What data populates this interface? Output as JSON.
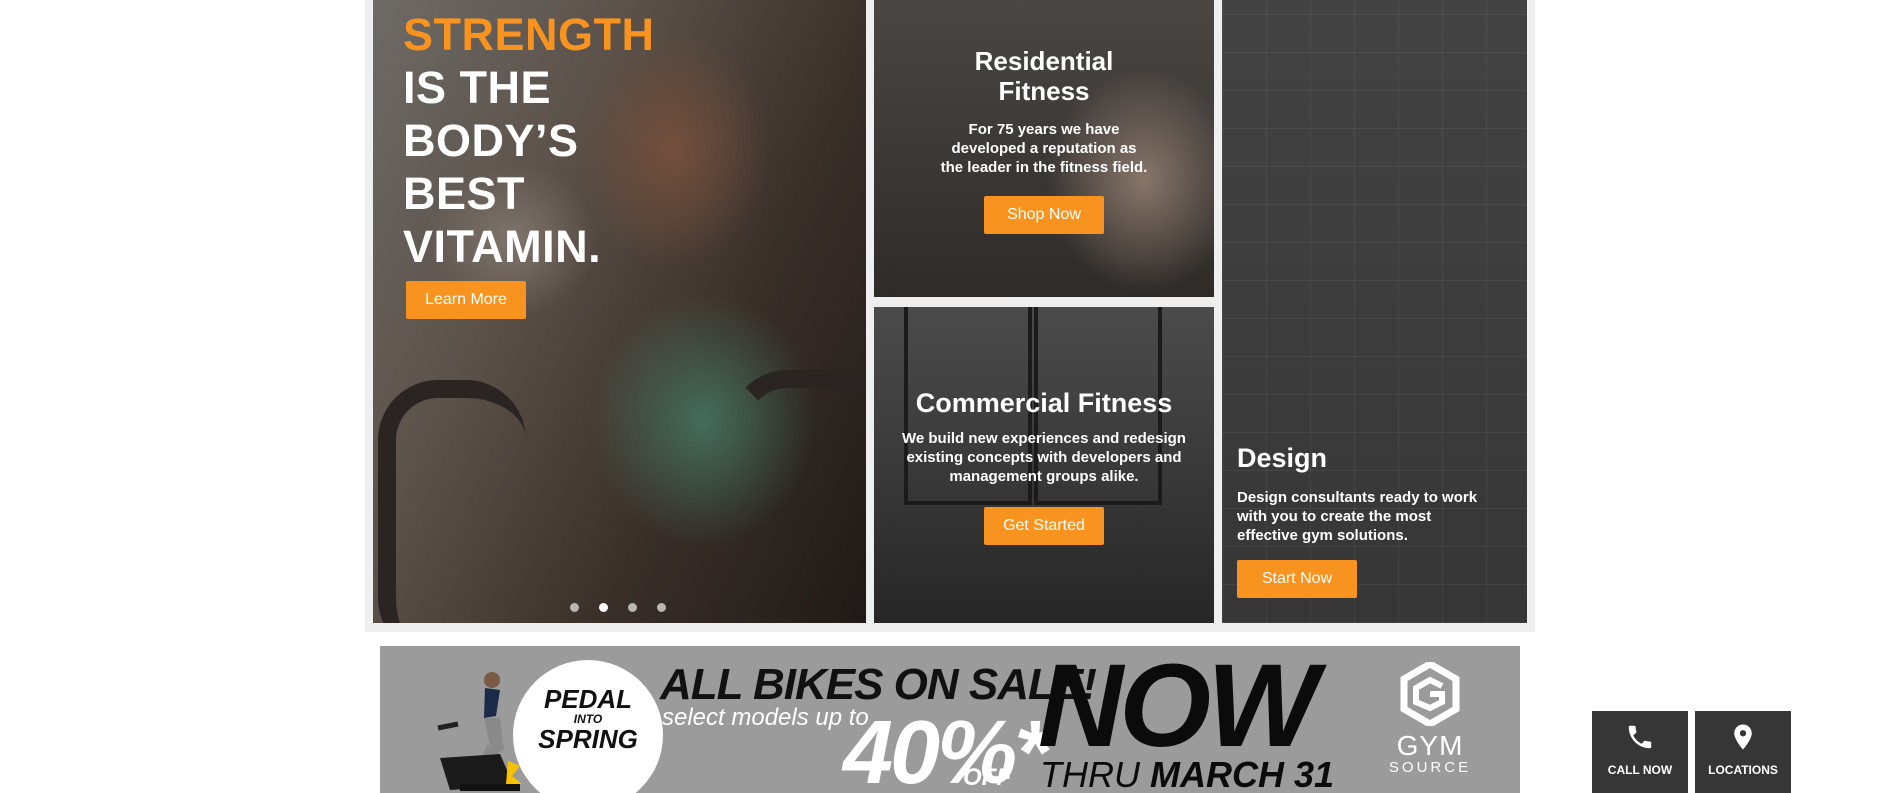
{
  "hero": {
    "title_line1": "STRENGTH",
    "title_line2": "IS THE",
    "title_line3": "BODY’S",
    "title_line4": "BEST",
    "title_line5": "VITAMIN.",
    "button": "Learn More",
    "slides": 4,
    "active_slide": 2
  },
  "residential": {
    "title_line1": "Residential",
    "title_line2": "Fitness",
    "desc_line1": "For 75 years we have",
    "desc_line2": "developed a reputation as",
    "desc_line3": "the leader in the fitness field.",
    "button": "Shop Now"
  },
  "commercial": {
    "title": "Commercial Fitness",
    "desc_line1": "We build new experiences and redesign",
    "desc_line2": "existing concepts with developers and",
    "desc_line3": "management groups alike.",
    "button": "Get Started"
  },
  "design": {
    "title": "Design",
    "desc_line1": "Design consultants ready to work",
    "desc_line2": "with you to create the most",
    "desc_line3": "effective gym solutions.",
    "button": "Start Now"
  },
  "banner": {
    "circle_line1": "PEDAL",
    "circle_line2": "INTO",
    "circle_line3": "SPRING",
    "headline": "ALL BIKES ON SALE!",
    "subline": "select models up to",
    "percent": "40%*",
    "off": "OFF",
    "now": "NOW",
    "thru": "THRU",
    "date": "MARCH 31",
    "logo_name": "GYM",
    "logo_sub": "SOURCE"
  },
  "floating": {
    "call": "CALL NOW",
    "locations": "LOCATIONS"
  },
  "colors": {
    "accent": "#f7931e",
    "dark_button": "#363636"
  },
  "icons": {
    "call": "phone-icon",
    "locations": "map-pin-icon"
  }
}
